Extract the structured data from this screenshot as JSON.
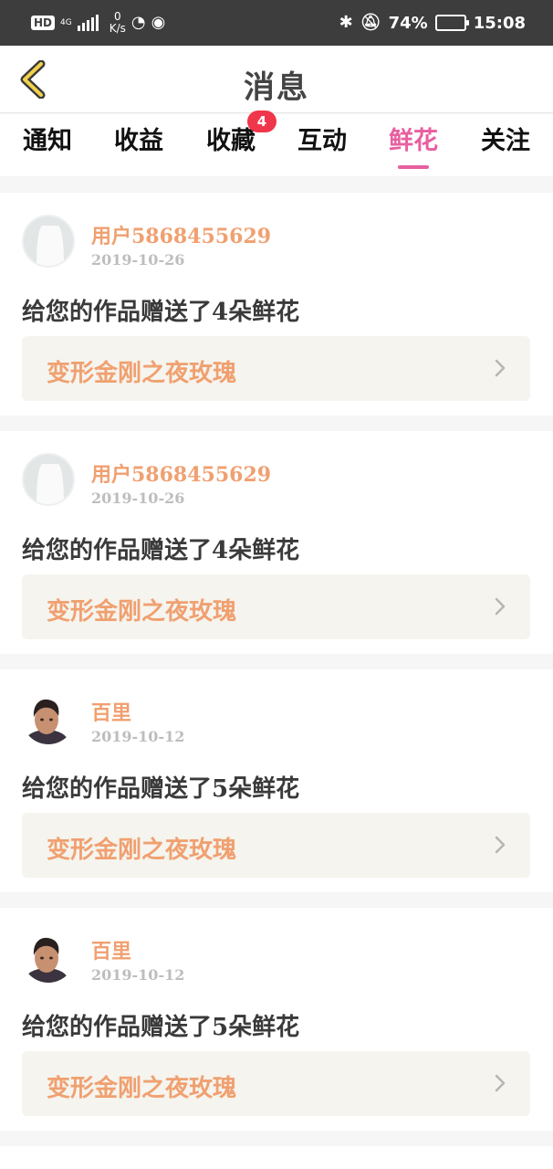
{
  "status_bar": {
    "hd": "HD",
    "network": "4G",
    "net_speed_value": "0",
    "net_speed_unit": "K/s",
    "battery": "74%",
    "battery_level": 0.74,
    "time": "15:08"
  },
  "header": {
    "back_icon": "chevron-left-icon",
    "title": "消息"
  },
  "tabs": [
    {
      "label": "通知"
    },
    {
      "label": "收益"
    },
    {
      "label": "收藏",
      "badge": "4"
    },
    {
      "label": "互动"
    },
    {
      "label": "鲜花",
      "active": true
    },
    {
      "label": "关注"
    }
  ],
  "colors": {
    "accent": "#e85fa0",
    "username": "#f0a070",
    "badge": "#f0364a",
    "link_bg": "#f5f4ee",
    "status_bar": "#3d3d3d"
  },
  "feed": [
    {
      "user": "用户5868455629",
      "date": "2019-10-26",
      "message": "给您的作品赠送了4朵鲜花",
      "work": "变形金刚之夜玫瑰",
      "avatar": "default-avatar"
    },
    {
      "user": "用户5868455629",
      "date": "2019-10-26",
      "message": "给您的作品赠送了4朵鲜花",
      "work": "变形金刚之夜玫瑰",
      "avatar": "default-avatar"
    },
    {
      "user": "百里",
      "date": "2019-10-12",
      "message": "给您的作品赠送了5朵鲜花",
      "work": "变形金刚之夜玫瑰",
      "avatar": "photo-avatar"
    },
    {
      "user": "百里",
      "date": "2019-10-12",
      "message": "给您的作品赠送了5朵鲜花",
      "work": "变形金刚之夜玫瑰",
      "avatar": "photo-avatar"
    }
  ]
}
